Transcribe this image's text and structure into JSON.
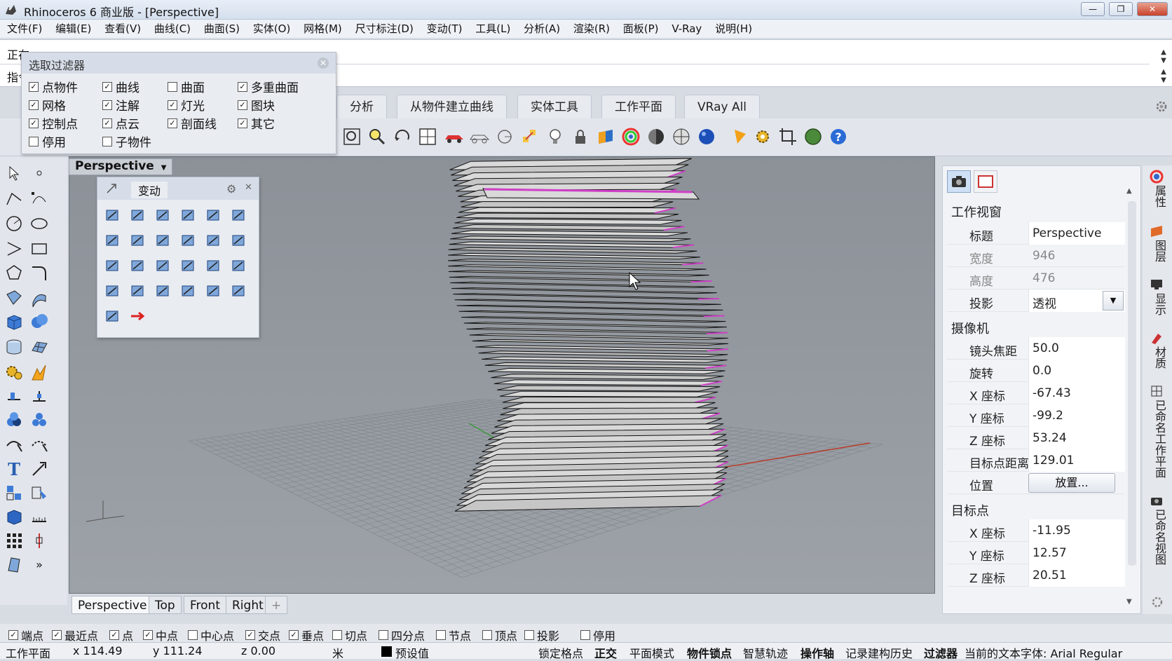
{
  "window": {
    "title": "Rhinoceros 6 商业版 - [Perspective]",
    "min_glyph": "—",
    "max_glyph": "❐",
    "close_glyph": "✕"
  },
  "menu": [
    "文件(F)",
    "编辑(E)",
    "查看(V)",
    "曲线(C)",
    "曲面(S)",
    "实体(O)",
    "网格(M)",
    "尺寸标注(D)",
    "变动(T)",
    "工具(L)",
    "分析(A)",
    "渲染(R)",
    "面板(P)",
    "V-Ray",
    "说明(H)"
  ],
  "command": {
    "history_line": "正在",
    "prompt_line": "指令"
  },
  "toolbar_tabs": [
    "分析",
    "从物件建立曲线",
    "实体工具",
    "工作平面",
    "VRay All"
  ],
  "select_filter": {
    "title": "选取过滤器",
    "close_glyph": "✕",
    "items": [
      {
        "label": "点物件",
        "checked": true
      },
      {
        "label": "曲线",
        "checked": true
      },
      {
        "label": "曲面",
        "checked": false
      },
      {
        "label": "多重曲面",
        "checked": true
      },
      {
        "label": "网格",
        "checked": true
      },
      {
        "label": "注解",
        "checked": true
      },
      {
        "label": "灯光",
        "checked": true
      },
      {
        "label": "图块",
        "checked": true
      },
      {
        "label": "控制点",
        "checked": true
      },
      {
        "label": "点云",
        "checked": true
      },
      {
        "label": "剖面线",
        "checked": true
      },
      {
        "label": "其它",
        "checked": true
      },
      {
        "label": "停用",
        "checked": false
      },
      {
        "label": "子物件",
        "checked": false
      }
    ]
  },
  "transform_panel": {
    "title": "变动",
    "gear_glyph": "⚙",
    "close_glyph": "✕"
  },
  "viewport": {
    "label": "Perspective",
    "dropdown_glyph": "▼",
    "tabs": [
      "Perspective",
      "Top",
      "Front",
      "Right"
    ],
    "add_tab_glyph": "+"
  },
  "properties": {
    "section_viewport": "工作视窗",
    "title_label": "标题",
    "title_value": "Perspective",
    "width_label": "宽度",
    "width_value": "946",
    "height_label": "高度",
    "height_value": "476",
    "projection_label": "投影",
    "projection_value": "透视",
    "section_camera": "摄像机",
    "lens_label": "镜头焦距",
    "lens_value": "50.0",
    "rotation_label": "旋转",
    "rotation_value": "0.0",
    "cam_x_label": "X 座标",
    "cam_x_value": "-67.43",
    "cam_y_label": "Y 座标",
    "cam_y_value": "-99.2",
    "cam_z_label": "Z 座标",
    "cam_z_value": "53.24",
    "target_dist_label": "目标点距离",
    "target_dist_value": "129.01",
    "location_label": "位置",
    "place_button": "放置...",
    "section_target": "目标点",
    "tgt_x_label": "X 座标",
    "tgt_x_value": "-11.95",
    "tgt_y_label": "Y 座标",
    "tgt_y_value": "12.57",
    "tgt_z_label": "Z 座标",
    "tgt_z_value": "20.51"
  },
  "side_tabs": [
    "属性",
    "图层",
    "显示",
    "材质",
    "已命名工作平面",
    "已命名视图"
  ],
  "osnap": [
    {
      "label": "端点",
      "checked": true
    },
    {
      "label": "最近点",
      "checked": true
    },
    {
      "label": "点",
      "checked": true
    },
    {
      "label": "中点",
      "checked": true
    },
    {
      "label": "中心点",
      "checked": false
    },
    {
      "label": "交点",
      "checked": true
    },
    {
      "label": "垂点",
      "checked": true
    },
    {
      "label": "切点",
      "checked": false
    },
    {
      "label": "四分点",
      "checked": false
    },
    {
      "label": "节点",
      "checked": false
    },
    {
      "label": "顶点",
      "checked": false
    },
    {
      "label": "投影",
      "checked": false
    },
    {
      "label": "停用",
      "checked": false
    }
  ],
  "status": {
    "cplane": "工作平面",
    "x": "x 114.49",
    "y": "y 111.24",
    "z": "z 0.00",
    "unit": "米",
    "layer": "预设值",
    "grid_snap": "锁定格点",
    "ortho": "正交",
    "planar": "平面模式",
    "osnap": "物件锁点",
    "smarttrack": "智慧轨迹",
    "gumball": "操作轴",
    "history": "记录建构历史",
    "filter": "过滤器",
    "font": "当前的文本字体: Arial Regular"
  },
  "colors": {
    "viewport_bg": "#8e939a",
    "object_fill": "#d4d4d4",
    "object_edge": "#000000",
    "highlight": "#d040c8"
  }
}
